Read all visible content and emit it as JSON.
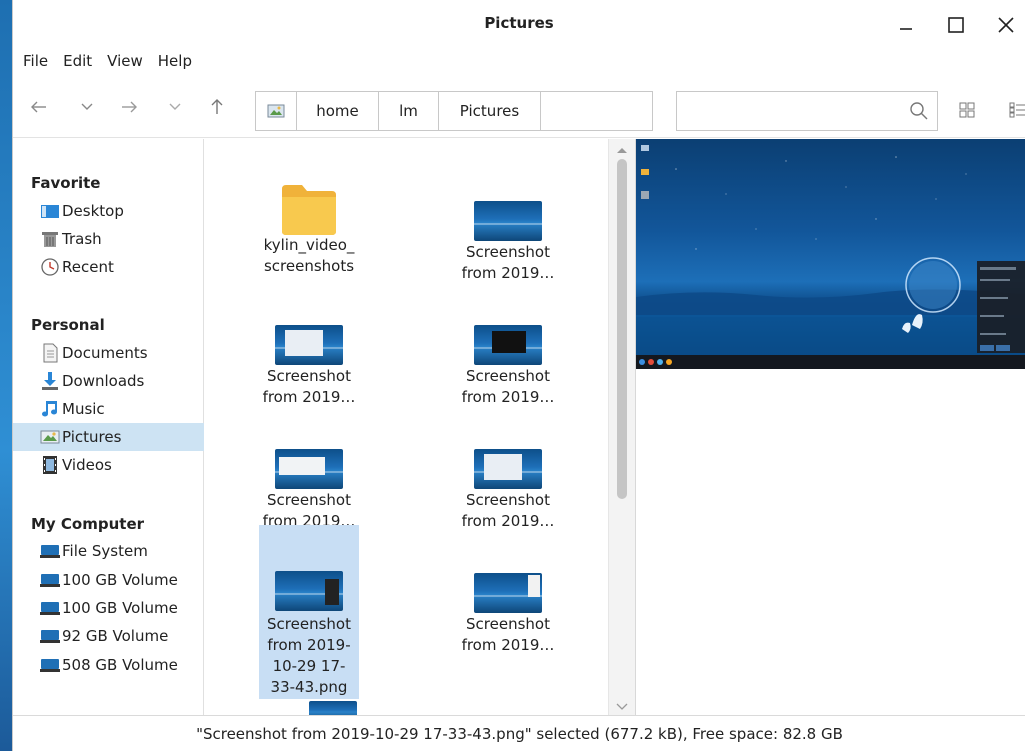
{
  "window": {
    "title": "Pictures",
    "controls": [
      "minimize-icon",
      "maximize-icon",
      "close-icon"
    ]
  },
  "menu": [
    "File",
    "Edit",
    "View",
    "Help"
  ],
  "breadcrumb": {
    "icon": "image-folder-icon",
    "parts": [
      "home",
      "lm",
      "Pictures"
    ]
  },
  "search": {
    "value": "",
    "placeholder": ""
  },
  "sidebar": {
    "sections": [
      {
        "title": "Favorite",
        "items": [
          {
            "label": "Desktop",
            "icon": "desktop-icon"
          },
          {
            "label": "Trash",
            "icon": "trash-icon"
          },
          {
            "label": "Recent",
            "icon": "clock-icon"
          }
        ]
      },
      {
        "title": "Personal",
        "items": [
          {
            "label": "Documents",
            "icon": "document-icon"
          },
          {
            "label": "Downloads",
            "icon": "download-icon"
          },
          {
            "label": "Music",
            "icon": "music-icon"
          },
          {
            "label": "Pictures",
            "icon": "picture-icon",
            "selected": true
          },
          {
            "label": "Videos",
            "icon": "video-icon"
          }
        ]
      },
      {
        "title": "My Computer",
        "items": [
          {
            "label": "File System",
            "icon": "drive-icon"
          },
          {
            "label": "100 GB Volume",
            "icon": "drive-icon"
          },
          {
            "label": "100 GB Volume",
            "icon": "drive-icon"
          },
          {
            "label": "92 GB Volume",
            "icon": "drive-icon"
          },
          {
            "label": "508 GB Volume",
            "icon": "drive-icon"
          }
        ]
      }
    ]
  },
  "files": [
    {
      "line1": "kylin_video_",
      "line2": "screenshots",
      "kind": "folder"
    },
    {
      "line1": "Screenshot",
      "line2": "from 2019…",
      "kind": "image"
    },
    {
      "line1": "Screenshot",
      "line2": "from 2019…",
      "kind": "image"
    },
    {
      "line1": "Screenshot",
      "line2": "from 2019…",
      "kind": "image"
    },
    {
      "line1": "Screenshot",
      "line2": "from 2019…",
      "kind": "image"
    },
    {
      "line1": "Screenshot",
      "line2": "from 2019…",
      "kind": "image"
    },
    {
      "line1": "Screenshot",
      "line2": "from 2019-",
      "line3": "10-29 17-",
      "line4": "33-43.png",
      "kind": "image",
      "selected": true
    },
    {
      "line1": "Screenshot",
      "line2": "from 2019…",
      "kind": "image"
    }
  ],
  "status": {
    "text": "\"Screenshot from 2019-10-29 17-33-43.png\" selected (677.2 kB), Free space: 82.8 GB"
  },
  "colors": {
    "accent": "#2a7fc1",
    "selection": "#c8def4",
    "sidebar_selection": "#cde3f3"
  }
}
